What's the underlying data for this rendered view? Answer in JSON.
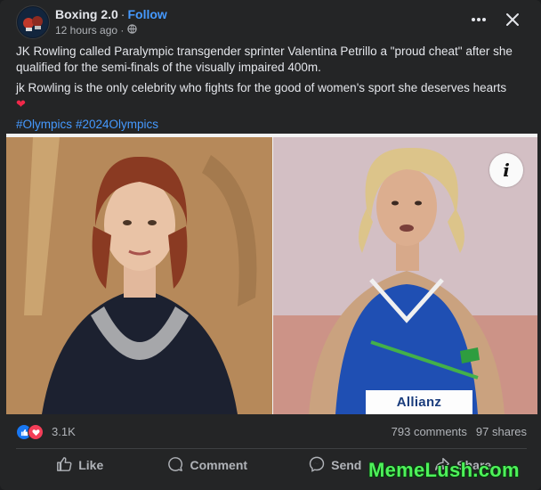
{
  "post": {
    "page_name": "Boxing 2.0",
    "separator": "·",
    "follow_label": "Follow",
    "time": "12 hours ago ·",
    "text_1": "JK Rowling called Paralympic transgender sprinter Valentina Petrillo a \"proud cheat\" after she qualified for the semi-finals of the visually impaired 400m.",
    "text_2": "jk Rowling is the only celebrity who fights for the good of women's sport she deserves hearts",
    "heart": "❤",
    "hashtags": [
      "#Olympics",
      "#2024Olympics"
    ]
  },
  "media": {
    "info_label": "i",
    "bib_text": "Allianz"
  },
  "stats": {
    "reaction_count": "3.1K",
    "comments": "793 comments",
    "shares": "97 shares"
  },
  "actions": {
    "like": "Like",
    "comment": "Comment",
    "send": "Send",
    "share": "Share"
  },
  "watermark": "MemeLush.com",
  "colors": {
    "background": "#242526",
    "text": "#e4e6eb",
    "muted": "#b0b3b8",
    "link": "#4599ff",
    "like_blue": "#1877f2",
    "love_red": "#f33e58",
    "watermark_green": "#4ef25a"
  },
  "icons": [
    "page-avatar",
    "globe-icon",
    "more-options-icon",
    "close-icon",
    "info-icon",
    "like-reaction-icon",
    "love-reaction-icon",
    "thumbs-up-icon",
    "comment-icon",
    "messenger-icon",
    "share-icon"
  ]
}
